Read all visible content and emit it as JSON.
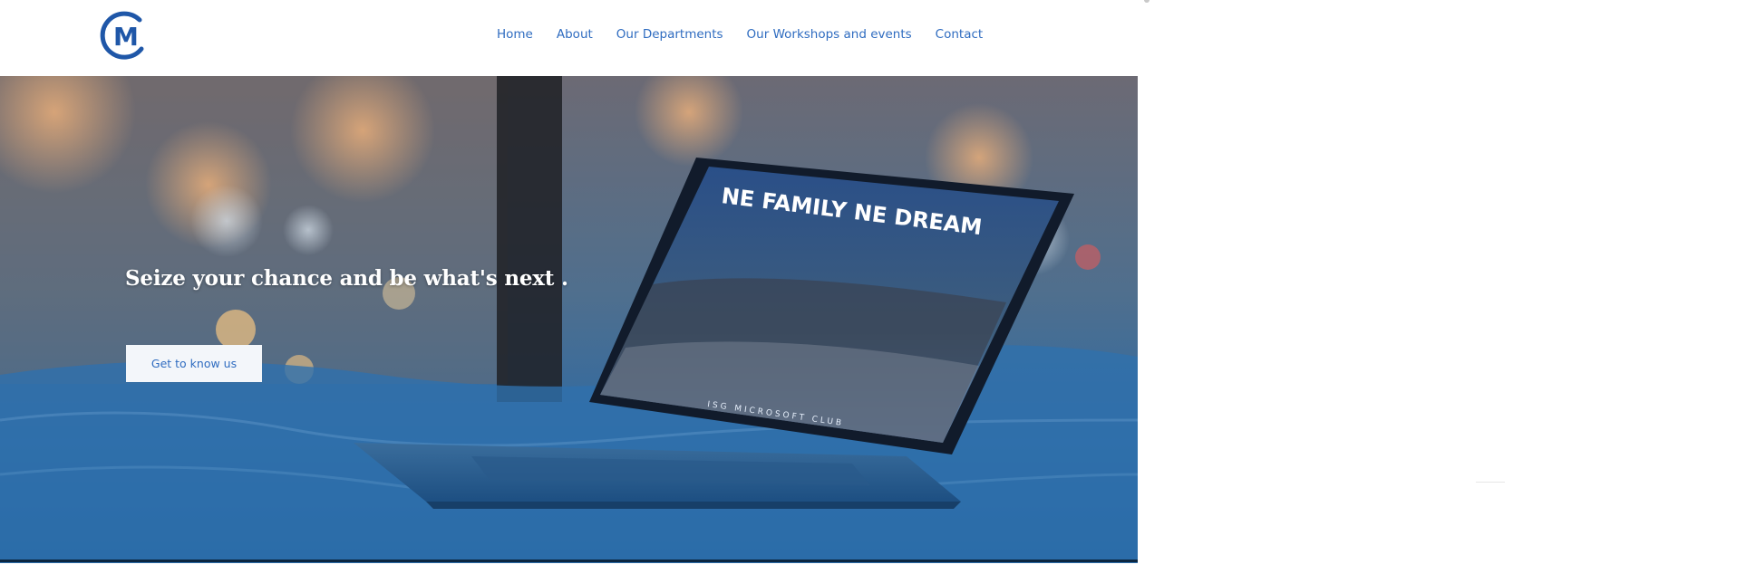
{
  "header": {
    "logo": {
      "icon": "club-logo-cm",
      "letter": "M"
    },
    "nav": [
      {
        "label": "Home"
      },
      {
        "label": "About"
      },
      {
        "label": "Our Departments"
      },
      {
        "label": "Our Workshops and events"
      },
      {
        "label": "Contact"
      }
    ]
  },
  "hero": {
    "title": "Seize your chance and be what's next .",
    "cta_label": "Get to know us",
    "laptop_screen": {
      "headline": "NE FAMILY NE DREAM",
      "footer": "ISG MICROSOFT CLUB"
    }
  },
  "colors": {
    "accent": "#2f6cc0",
    "hero_bottom": "#1a5c9a",
    "cta_bg": "#f3f6fa"
  }
}
